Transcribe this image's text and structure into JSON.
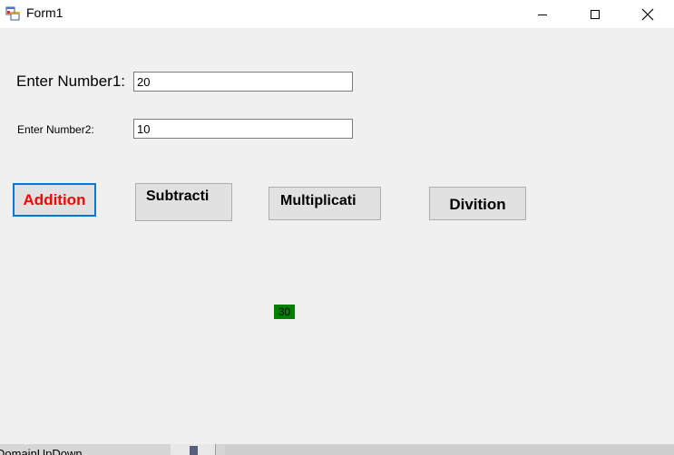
{
  "window": {
    "title": "Form1"
  },
  "form": {
    "label1": "Enter Number1:",
    "label2": "Enter Number2:",
    "number1_value": "20",
    "number2_value": "10"
  },
  "buttons": {
    "addition": "Addition",
    "subtraction": "Subtracti",
    "multiplication": "Multiplicati",
    "division": "Divition"
  },
  "result": {
    "value": "30"
  },
  "background_panel": {
    "text": "DomainUpDown"
  },
  "colors": {
    "addition_text": "#ff0000",
    "focus_border": "#0078d7",
    "result_background": "#008000"
  }
}
